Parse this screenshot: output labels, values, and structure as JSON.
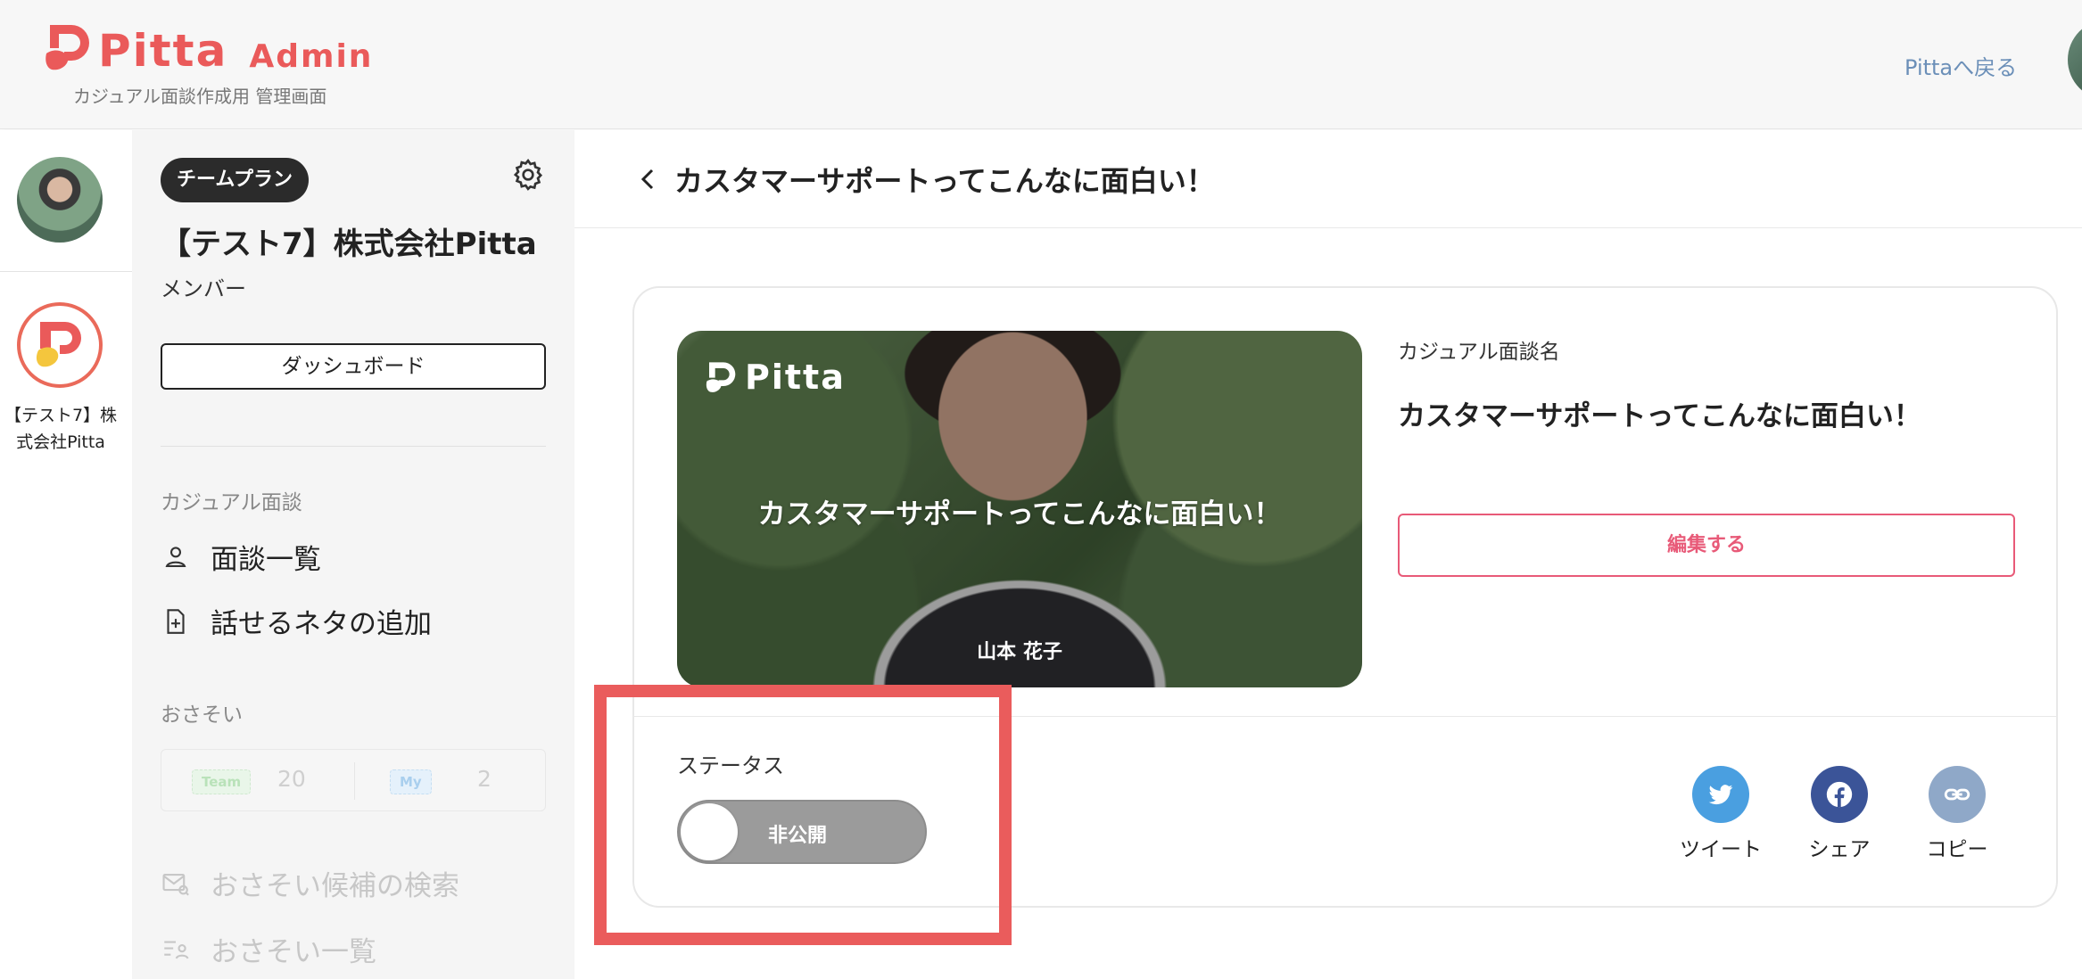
{
  "header": {
    "brand": "Pitta",
    "brand_suffix": "Admin",
    "subtitle": "カジュアル面談作成用 管理画面",
    "back_link": "Pittaへ戻る"
  },
  "rail": {
    "company_label": "【テスト7】株式会社Pitta"
  },
  "sidebar": {
    "plan_badge": "チームプラン",
    "company_name": "【テスト7】株式会社Pitta",
    "role": "メンバー",
    "dashboard_button": "ダッシュボード",
    "section_casual": "カジュアル面談",
    "nav_interviews": "面談一覧",
    "nav_add_topic": "話せるネタの追加",
    "section_osasoi": "おさそい",
    "osasoi_team_tag": "Team",
    "osasoi_team_count": "20",
    "osasoi_my_tag": "My",
    "osasoi_my_count": "2",
    "nav_search_candidates": "おさそい候補の検索",
    "nav_osasoi_list": "おさそい一覧"
  },
  "main": {
    "title": "カスタマーサポートってこんなに面白い！",
    "thumbnail": {
      "logo": "Pitta",
      "title": "カスタマーサポートってこんなに面白い！",
      "person_name": "山本 花子"
    },
    "field_label": "カジュアル面談名",
    "field_value": "カスタマーサポートってこんなに面白い！",
    "edit_button": "編集する",
    "status_label": "ステータス",
    "status_toggle": "非公開",
    "share": {
      "tweet": "ツイート",
      "facebook": "シェア",
      "copy": "コピー"
    }
  },
  "colors": {
    "brand": "#ea5a5a",
    "edit_border": "#e85a78",
    "twitter": "#4a9fe0",
    "facebook": "#3b5498",
    "copy": "#8fa8c8",
    "highlight": "#ea5c5c"
  }
}
